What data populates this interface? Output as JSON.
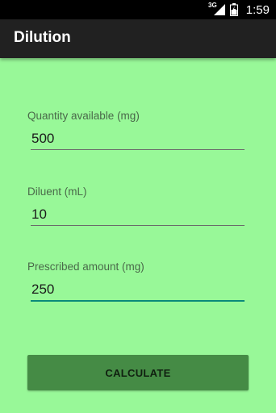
{
  "status_bar": {
    "network_type": "3G",
    "time": "1:59"
  },
  "app": {
    "title": "Dilution"
  },
  "form": {
    "quantity_available": {
      "label": "Quantity available (mg)",
      "value": "500"
    },
    "diluent": {
      "label": "Diluent (mL)",
      "value": "10"
    },
    "prescribed_amount": {
      "label": "Prescribed amount (mg)",
      "value": "250"
    },
    "calculate_label": "CALCULATE"
  },
  "colors": {
    "background": "#98F898",
    "action_bar": "#212121",
    "button": "#458B45",
    "focus_underline": "#0a8a7a"
  },
  "icons": [
    "signal-icon",
    "battery-icon"
  ]
}
